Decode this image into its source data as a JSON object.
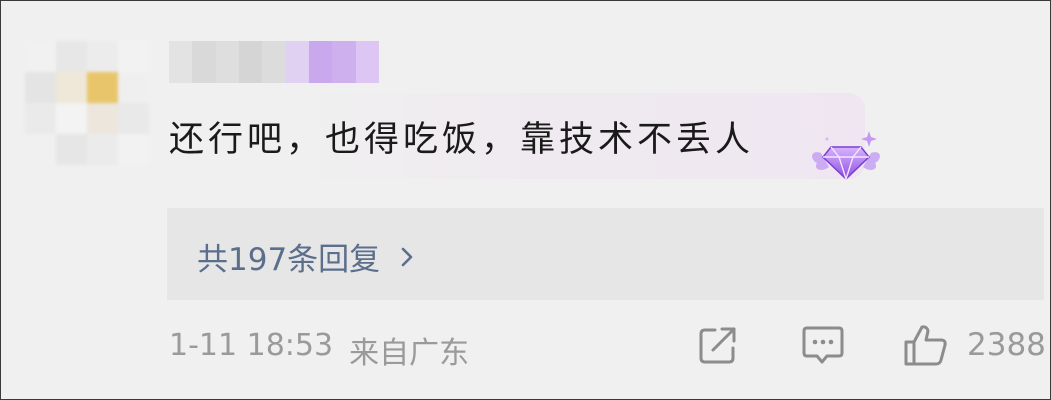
{
  "comment": {
    "text": "还行吧，也得吃饭，靠技术不丢人",
    "badge_icon": "diamond-wings-badge-icon"
  },
  "replies": {
    "label": "共197条回复",
    "chevron_icon": "chevron-right-icon"
  },
  "meta": {
    "time": "1-11 18:53",
    "location": "来自广东"
  },
  "actions": {
    "share_icon": "share-icon",
    "comment_icon": "comment-icon",
    "like_icon": "thumbs-up-icon",
    "like_count": "2388"
  },
  "colors": {
    "background": "#f0f0f0",
    "replies_background": "#e6e6e6",
    "link": "#5b6f8c",
    "meta_text": "#9a9a9a",
    "badge_purple": "#a56ae0"
  }
}
